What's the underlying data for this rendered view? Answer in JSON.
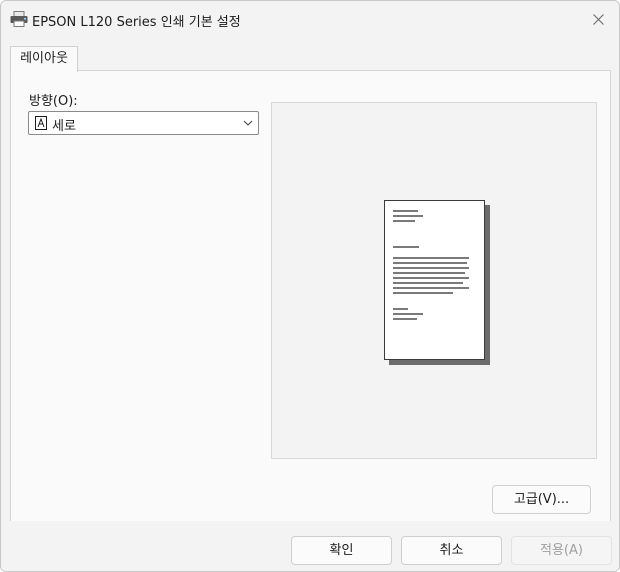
{
  "window": {
    "title": "EPSON L120 Series 인쇄 기본 설정",
    "title_icon": "printer-icon",
    "close_icon": "close-icon"
  },
  "tabs": [
    {
      "label": "레이아웃",
      "selected": true
    }
  ],
  "orientation": {
    "label": "방향(O):",
    "selected_value": "세로",
    "value_icon": "portrait-page-icon",
    "dropdown_icon": "chevron-down-icon"
  },
  "preview": {
    "description_icon": "document-preview-icon"
  },
  "buttons": {
    "advanced": "고급(V)...",
    "ok": "확인",
    "cancel": "취소",
    "apply": "적용(A)"
  },
  "colors": {
    "window_bg": "#f3f3f3",
    "panel_bg": "#fafafa",
    "disabled_text": "#a0a0a0"
  }
}
